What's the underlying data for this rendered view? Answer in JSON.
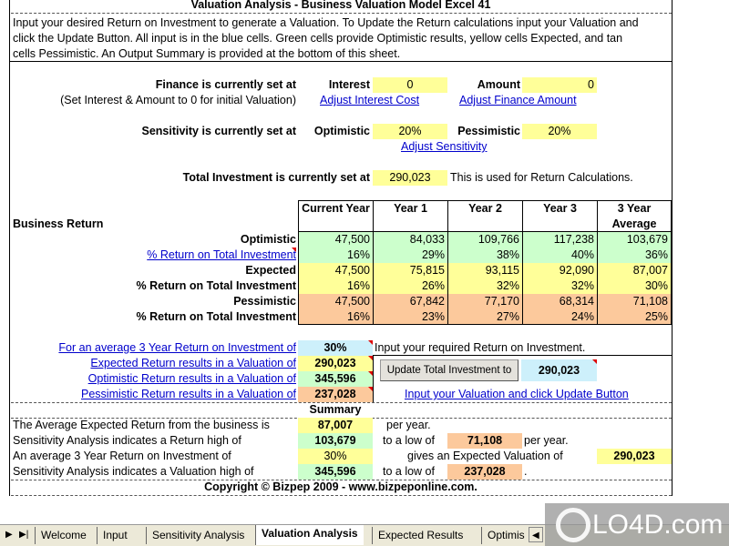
{
  "title": "Valuation Analysis - Business Valuation Model Excel 41",
  "intro": [
    "Input your desired Return on Investment to generate a Valuation. To Update the Return calculations input your Valuation and",
    "click the Update Button. All input is in the blue cells. Green cells provide Optimistic results, yellow cells Expected, and tan",
    "cells Pessimistic. An Output Summary is provided at the bottom of this sheet."
  ],
  "finance": {
    "label": "Finance is currently set at",
    "note": "(Set Interest & Amount to 0 for initial Valuation)",
    "interest_label": "Interest",
    "interest": "0",
    "amount_label": "Amount",
    "amount": "0",
    "adjust_interest": "Adjust Interest Cost",
    "adjust_amount": "Adjust Finance Amount"
  },
  "sensitivity": {
    "label": "Sensitivity is currently set at",
    "optimistic_label": "Optimistic",
    "optimistic": "20%",
    "pessimistic_label": "Pessimistic",
    "pessimistic": "20%",
    "adjust": "Adjust Sensitivity"
  },
  "total": {
    "label": "Total Investment is currently set at",
    "value": "290,023",
    "note": "This is used for Return Calculations."
  },
  "business": {
    "label": "Business Return",
    "headers": [
      "Current Year",
      "Year 1",
      "Year 2",
      "Year 3",
      "3 Year Average"
    ],
    "rows": [
      {
        "label": "Optimistic",
        "link": false,
        "color": "g",
        "values": [
          "47,500",
          "84,033",
          "109,766",
          "117,238",
          "103,679"
        ]
      },
      {
        "label": "% Return on Total Investment",
        "link": true,
        "color": "g",
        "values": [
          "16%",
          "29%",
          "38%",
          "40%",
          "36%"
        ]
      },
      {
        "label": "Expected",
        "link": false,
        "color": "y",
        "values": [
          "47,500",
          "75,815",
          "93,115",
          "92,090",
          "87,007"
        ]
      },
      {
        "label": "% Return on Total Investment",
        "link": false,
        "color": "y",
        "values": [
          "16%",
          "26%",
          "32%",
          "32%",
          "30%"
        ]
      },
      {
        "label": "Pessimistic",
        "link": false,
        "color": "t",
        "values": [
          "47,500",
          "67,842",
          "77,170",
          "68,314",
          "71,108"
        ]
      },
      {
        "label": "% Return on Total Investment",
        "link": false,
        "color": "t",
        "values": [
          "16%",
          "23%",
          "27%",
          "24%",
          "25%"
        ]
      }
    ]
  },
  "valuation": {
    "roi_label": "For an average 3 Year Return on Investment of",
    "roi": "30%",
    "roi_note": "Input your required Return on Investment.",
    "expected_label": "Expected Return results in a Valuation of",
    "expected": "290,023",
    "optimistic_label": "Optimistic Return results in a Valuation of",
    "optimistic": "345,596",
    "pessimistic_label": "Pessimistic Return results in a Valuation of",
    "pessimistic": "237,028",
    "update_button": "Update Total Investment to",
    "update_value": "290,023",
    "update_link": "Input your Valuation and click Update Button"
  },
  "summary": {
    "title": "Summary",
    "l1": "The Average Expected Return from the business is",
    "v1": "87,007",
    "s1": "per year.",
    "l2": "Sensitivity Analysis indicates a Return high of",
    "v2": "103,679",
    "m2": "to a low of",
    "w2": "71,108",
    "s2": "per year.",
    "l3": "An average 3 Year Return on Investment of",
    "v3": "30%",
    "m3": "gives an Expected Valuation of",
    "w3": "290,023",
    "l4": "Sensitivity Analysis indicates a Valuation high of",
    "v4": "345,596",
    "m4": "to a low of",
    "w4": "237,028",
    "s4": "."
  },
  "copyright": "Copyright © Bizpep 2009 - www.bizpeponline.com.",
  "tabs": [
    "Welcome",
    "Input",
    "Sensitivity Analysis",
    "Valuation Analysis",
    "Expected Results",
    "Optimis"
  ],
  "active_tab": "Valuation Analysis",
  "watermark": "LO4D.com"
}
